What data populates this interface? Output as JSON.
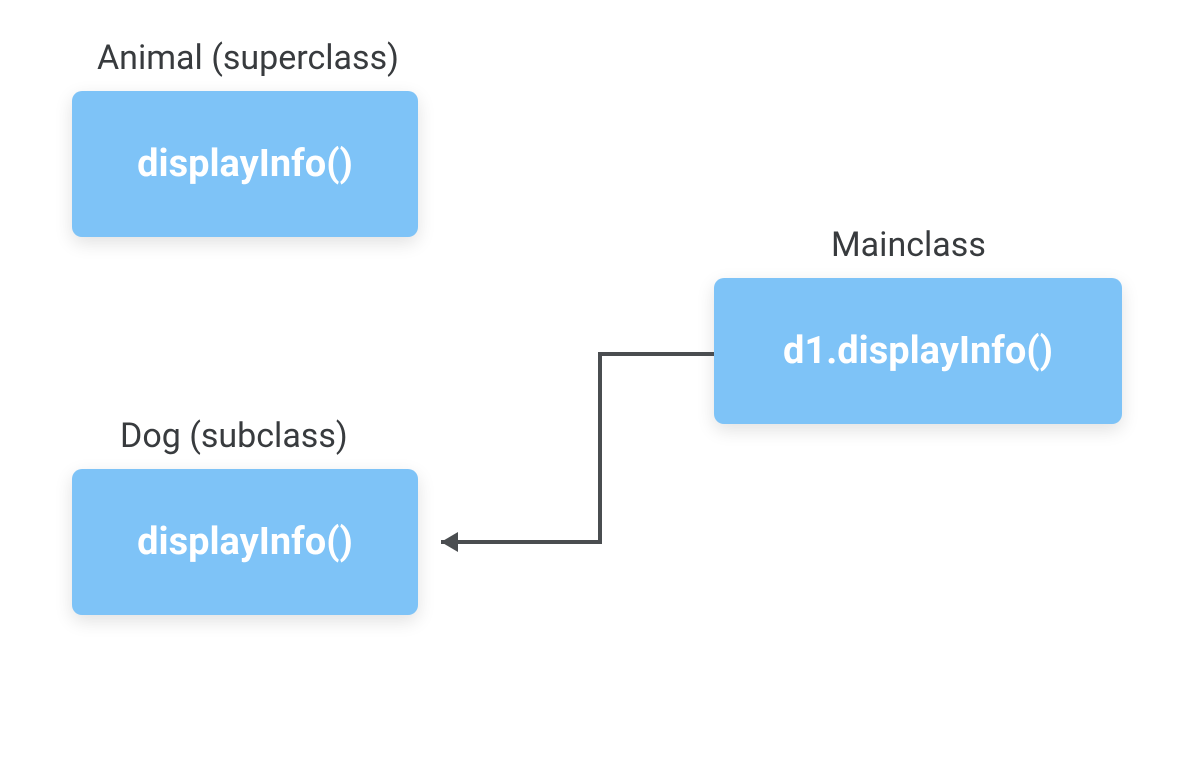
{
  "labels": {
    "animal": "Animal (superclass)",
    "dog": "Dog (subclass)",
    "main": "Mainclass"
  },
  "boxes": {
    "animal_method": "displayInfo()",
    "dog_method": "displayInfo()",
    "main_call": "d1.displayInfo()"
  },
  "colors": {
    "box_bg": "#7ec3f7",
    "box_text": "#ffffff",
    "label_text": "#383b3e",
    "arrow": "#4a4d50"
  }
}
